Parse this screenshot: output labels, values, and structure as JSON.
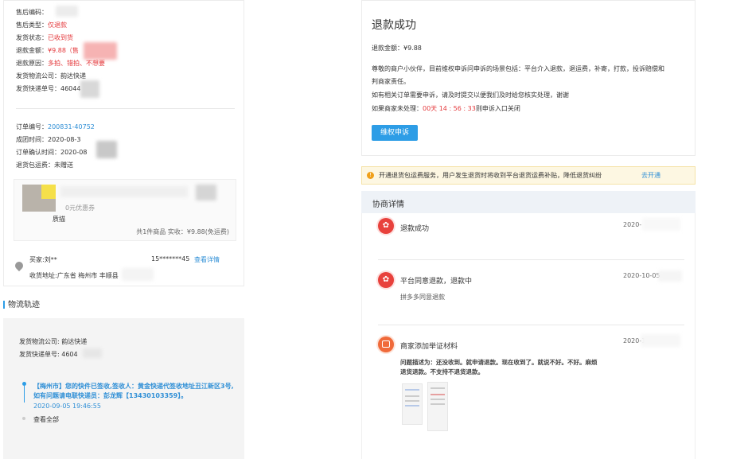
{
  "after_sale": {
    "no_label": "售后编码：",
    "type_label": "售后类型：",
    "type_value": "仅退款",
    "ship_status_label": "发货状态：",
    "ship_status_value": "已收到货",
    "amount_label": "退款金额：",
    "amount_value": "¥9.88（售",
    "reason_label": "退款原因：",
    "reason_value": "多拍、错拍、不想要",
    "company_label": "发货物流公司：",
    "company_value": "韵达快递",
    "tracking_label": "发货快递单号：",
    "tracking_value": "46044"
  },
  "order": {
    "no_label": "订单编号：",
    "no_value": "200831-40752",
    "created_label": "成团时间：",
    "created_value": "2020-08-3",
    "confirmed_label": "订单确认时间：",
    "confirmed_value": "2020-08",
    "fee_label": "退货包运费：",
    "fee_value": "未赠送",
    "coupon": "0元优惠券",
    "product_name": "质描",
    "total": "共1件商品   实收：¥9.88(免运费)"
  },
  "buyer": {
    "label": "买家:刘**",
    "phone": "15*******45",
    "detail_link": "查看详情",
    "address": "收货地址:广东省 梅州市 丰顺县"
  },
  "logistics": {
    "section_title": "物流轨迹",
    "company_label": "发货物流公司:",
    "company_value": "韵达快递",
    "tracking_label": "发货快递单号:",
    "tracking_value": "4604",
    "latest": "【梅州市】您的快件已签收,签收人：黄金快递代签收地址丑江新区3号,如有问题请电联快递员：彭龙辉【13430103359】。",
    "latest_time": "2020-09-05 19:46:55",
    "view_all": "查看全部"
  },
  "refund": {
    "title": "退款成功",
    "amount": "退款金额：¥9.88",
    "desc1": "尊敬的商户小伙伴，目前维权申诉问申诉的场景包括：平台介入退款，退运费，补寄，打款，投诉赔偿和",
    "desc2": "判商家责任。",
    "desc3": "如有相关订单需要申诉，请及时提交以便我们及时给您核实处理，谢谢",
    "desc4_a": "如果商家未处理：",
    "desc4_b": "00天 14 : 56 : 33",
    "desc4_c": "则申诉入口关闭",
    "appeal_button": "维权申诉"
  },
  "notice": {
    "text": "开通退货包运费服务，用户发生退货时将收到平台退货运费补贴，降低退货纠纷",
    "link": "去开通"
  },
  "negotiation": {
    "title": "协商详情",
    "items": [
      {
        "title": "退款成功",
        "time": "2020-",
        "body": ""
      },
      {
        "title": "平台同意退款，退款中",
        "time": "2020-10-05",
        "body": "拼多多同意退款"
      },
      {
        "title": "商家添加举证材料",
        "time": "2020-1",
        "body": "问题描述为：还没收到。就申请退款。现在收到了。就说不好。不好。麻烦退货退款。不支持不退货退款。"
      }
    ]
  },
  "colors": {
    "accent": "#2d9de6",
    "danger": "#e4393c",
    "notice_bg": "#fdf7e2"
  }
}
